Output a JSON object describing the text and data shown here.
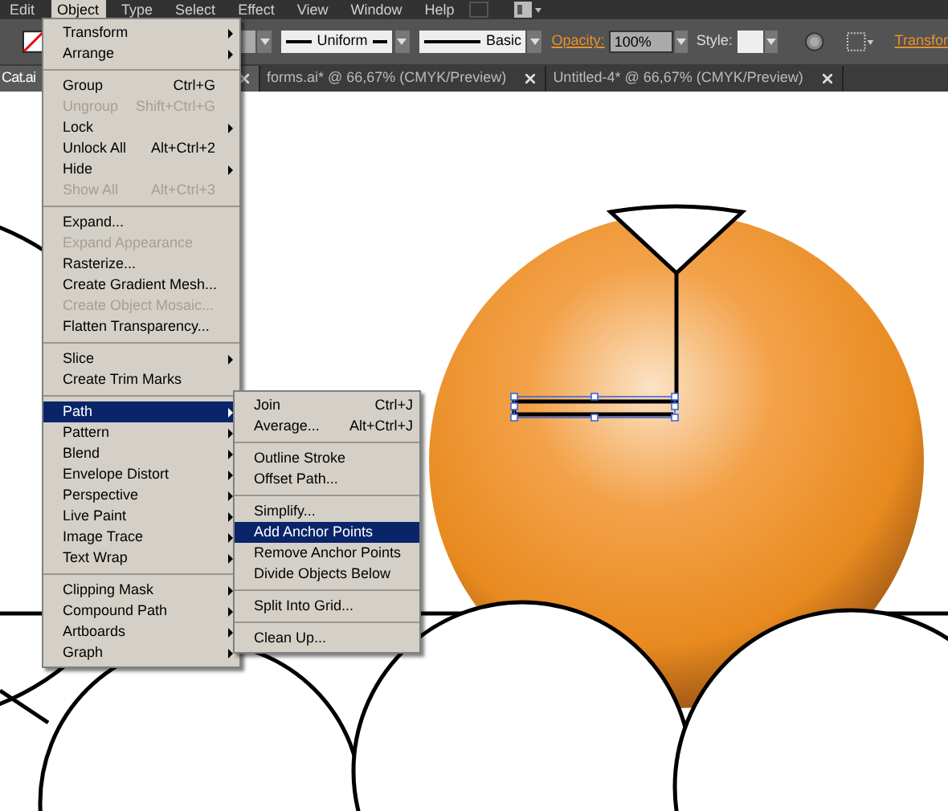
{
  "menubar": [
    {
      "label": "Edit",
      "selected": false
    },
    {
      "label": "Object",
      "selected": true
    },
    {
      "label": "Type",
      "selected": false
    },
    {
      "label": "Select",
      "selected": false
    },
    {
      "label": "Effect",
      "selected": false
    },
    {
      "label": "View",
      "selected": false
    },
    {
      "label": "Window",
      "selected": false
    },
    {
      "label": "Help",
      "selected": false
    }
  ],
  "toolbar": {
    "stroke_style": "Uniform",
    "brush": "Basic",
    "opacity_label": "Opacity:",
    "opacity": "100%",
    "style_label": "Style:",
    "transform": "Transfor"
  },
  "tabs": [
    {
      "title": "Cat.ai",
      "selected": true
    },
    {
      "title": "forms.ai* @ 66,67% (CMYK/Preview)",
      "selected": false
    },
    {
      "title": "Untitled-4* @ 66,67% (CMYK/Preview)",
      "selected": false
    }
  ],
  "object_menu": [
    [
      {
        "label": "Transform",
        "submenu": true,
        "disabled": false,
        "selected": false
      },
      {
        "label": "Arrange",
        "submenu": true,
        "disabled": false,
        "selected": false
      }
    ],
    [
      {
        "label": "Group",
        "shortcut": "Ctrl+G",
        "submenu": false,
        "disabled": false,
        "selected": false
      },
      {
        "label": "Ungroup",
        "shortcut": "Shift+Ctrl+G",
        "submenu": false,
        "disabled": true,
        "selected": false
      },
      {
        "label": "Lock",
        "submenu": true,
        "disabled": false,
        "selected": false
      },
      {
        "label": "Unlock All",
        "shortcut": "Alt+Ctrl+2",
        "submenu": false,
        "disabled": false,
        "selected": false
      },
      {
        "label": "Hide",
        "submenu": true,
        "disabled": false,
        "selected": false
      },
      {
        "label": "Show All",
        "shortcut": "Alt+Ctrl+3",
        "submenu": false,
        "disabled": true,
        "selected": false
      }
    ],
    [
      {
        "label": "Expand...",
        "submenu": false,
        "disabled": false,
        "selected": false
      },
      {
        "label": "Expand Appearance",
        "submenu": false,
        "disabled": true,
        "selected": false
      },
      {
        "label": "Rasterize...",
        "submenu": false,
        "disabled": false,
        "selected": false
      },
      {
        "label": "Create Gradient Mesh...",
        "submenu": false,
        "disabled": false,
        "selected": false
      },
      {
        "label": "Create Object Mosaic...",
        "submenu": false,
        "disabled": true,
        "selected": false
      },
      {
        "label": "Flatten Transparency...",
        "submenu": false,
        "disabled": false,
        "selected": false
      }
    ],
    [
      {
        "label": "Slice",
        "submenu": true,
        "disabled": false,
        "selected": false
      },
      {
        "label": "Create Trim Marks",
        "submenu": false,
        "disabled": false,
        "selected": false
      }
    ],
    [
      {
        "label": "Path",
        "submenu": true,
        "disabled": false,
        "selected": true
      },
      {
        "label": "Pattern",
        "submenu": true,
        "disabled": false,
        "selected": false
      },
      {
        "label": "Blend",
        "submenu": true,
        "disabled": false,
        "selected": false
      },
      {
        "label": "Envelope Distort",
        "submenu": true,
        "disabled": false,
        "selected": false
      },
      {
        "label": "Perspective",
        "submenu": true,
        "disabled": false,
        "selected": false
      },
      {
        "label": "Live Paint",
        "submenu": true,
        "disabled": false,
        "selected": false
      },
      {
        "label": "Image Trace",
        "submenu": true,
        "disabled": false,
        "selected": false
      },
      {
        "label": "Text Wrap",
        "submenu": true,
        "disabled": false,
        "selected": false
      }
    ],
    [
      {
        "label": "Clipping Mask",
        "submenu": true,
        "disabled": false,
        "selected": false
      },
      {
        "label": "Compound Path",
        "submenu": true,
        "disabled": false,
        "selected": false
      },
      {
        "label": "Artboards",
        "submenu": true,
        "disabled": false,
        "selected": false
      },
      {
        "label": "Graph",
        "submenu": true,
        "disabled": false,
        "selected": false
      }
    ]
  ],
  "path_submenu": [
    [
      {
        "label": "Join",
        "shortcut": "Ctrl+J",
        "selected": false
      },
      {
        "label": "Average...",
        "shortcut": "Alt+Ctrl+J",
        "selected": false
      }
    ],
    [
      {
        "label": "Outline Stroke",
        "selected": false
      },
      {
        "label": "Offset Path...",
        "selected": false
      }
    ],
    [
      {
        "label": "Simplify...",
        "selected": false
      },
      {
        "label": "Add Anchor Points",
        "selected": true
      },
      {
        "label": "Remove Anchor Points",
        "selected": false
      },
      {
        "label": "Divide Objects Below",
        "selected": false
      }
    ],
    [
      {
        "label": "Split Into Grid...",
        "selected": false
      }
    ],
    [
      {
        "label": "Clean Up...",
        "selected": false
      }
    ]
  ]
}
